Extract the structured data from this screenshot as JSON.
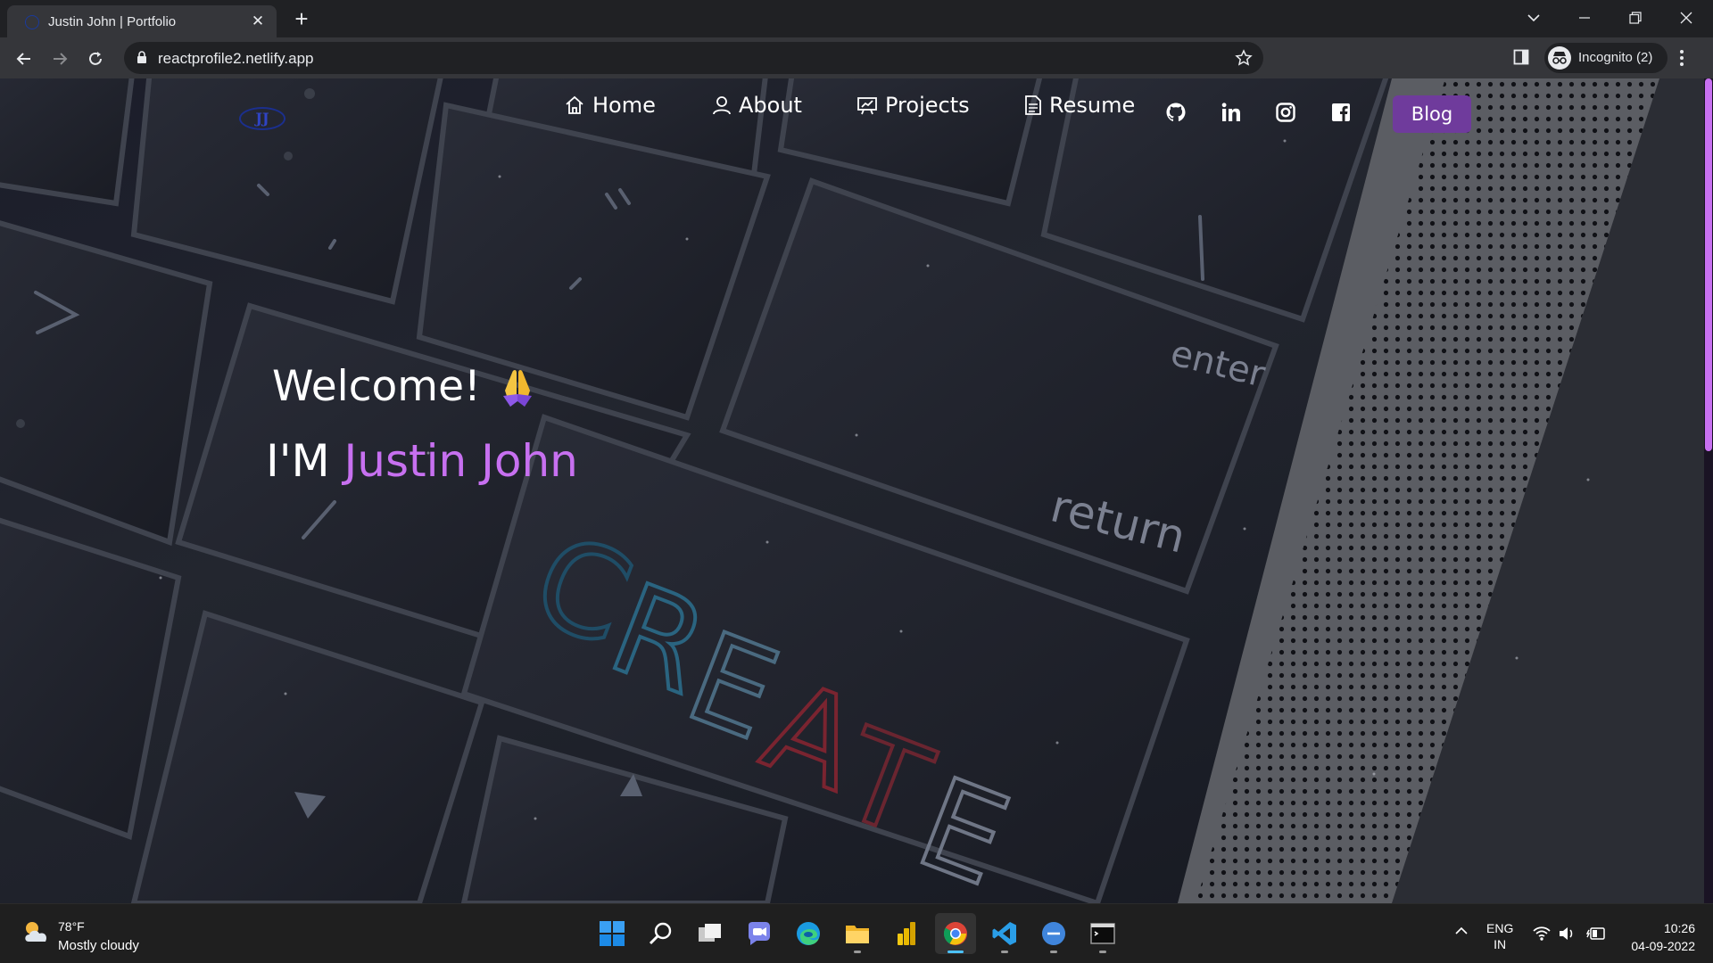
{
  "browser": {
    "tab_title": "Justin John | Portfolio",
    "url": "reactprofile2.netlify.app",
    "profile_label": "Incognito (2)"
  },
  "site": {
    "logo_text": "JJ",
    "nav": [
      {
        "label": "Home",
        "icon": "home-icon"
      },
      {
        "label": "About",
        "icon": "user-icon"
      },
      {
        "label": "Projects",
        "icon": "projects-icon"
      },
      {
        "label": "Resume",
        "icon": "document-icon"
      }
    ],
    "social": [
      "github-icon",
      "linkedin-icon",
      "instagram-icon",
      "facebook-icon"
    ],
    "blog_label": "Blog",
    "hero": {
      "welcome": "Welcome!",
      "im": "I'M",
      "name": "Justin John"
    },
    "background_keys": {
      "enter": "enter",
      "return": "return",
      "create": "CREATE"
    }
  },
  "taskbar": {
    "weather_temp": "78°F",
    "weather_desc": "Mostly cloudy",
    "lang_top": "ENG",
    "lang_bottom": "IN",
    "time": "10:26",
    "date": "04-09-2022",
    "apps": [
      "start-icon",
      "search-icon",
      "task-view-icon",
      "chat-icon",
      "edge-icon",
      "file-explorer-icon",
      "power-bi-icon",
      "chrome-icon",
      "vscode-icon",
      "canva-icon",
      "terminal-icon"
    ]
  },
  "colors": {
    "accent": "#c770f0",
    "blog_bg": "#6f3b9c",
    "chrome_dark": "#202124",
    "chrome_toolbar": "#35363a"
  }
}
